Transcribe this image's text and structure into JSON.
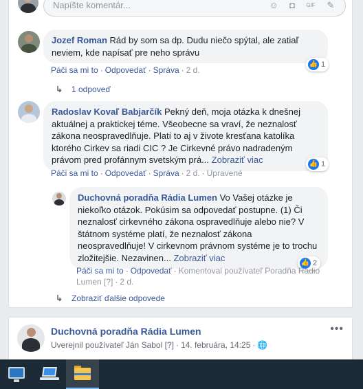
{
  "compose": {
    "placeholder": "Napíšte komentár...",
    "icons": [
      "emoji-icon",
      "camera-icon",
      "gif-icon",
      "sticker-icon"
    ]
  },
  "comments": [
    {
      "author": "Jozef Roman",
      "text": " Rád by som sa dp. Dudu niečo spýtal, ale zatiaľ neviem, kde napísať pre neho správu",
      "actions": {
        "like": "Páči sa mi to",
        "reply": "Odpovedať",
        "message": "Správa",
        "time": "2 d."
      },
      "reactions": "1",
      "replies_link": "1 odpoveď"
    },
    {
      "author": "Radoslav Kovaľ Babjarčík",
      "text": " Pekný deň, moja otázka k dnešnej aktuálnej a praktickej téme. Všeobecne sa vraví, že neznalosť zákona neospravedlňuje. Platí to aj v živote kresťana katolíka ktorého Cirkev sa riadi CIC ? Je Cirkevné právo nadradeným právom pred profánnym svetským prá...",
      "more": " Zobraziť viac",
      "actions": {
        "like": "Páči sa mi to",
        "reply": "Odpovedať",
        "message": "Správa",
        "time": "2 d.",
        "edited": "Upravené"
      },
      "reactions": "1"
    }
  ],
  "reply": {
    "author": "Duchovná poradňa Rádia Lumen",
    "text": " Vo Vašej otázke je niekoľko otázok. Pokúsim sa odpovedať postupne. (1) Či neznalosť cirkevného zákona ospravedlňuje alebo nie? V štátnom systéme platí, že neznalosť zákona neospravedlňuje! V cirkevnom právnom systéme je to trochu zložitejšie. Nezavinen...",
    "more": " Zobraziť viac",
    "actions": {
      "like": "Páči sa mi to",
      "reply": "Odpovedať",
      "commented_by": "Komentoval používateľ Poradňa Rádio",
      "commented_by_2": "Lumen",
      "q": "[?]",
      "time": "2 d."
    },
    "reactions": "2"
  },
  "more_replies": "Zobraziť ďalšie odpovede",
  "post": {
    "author": "Duchovná poradňa Rádia Lumen",
    "published_by": "Uverejnil používateľ Ján Sabol",
    "q": "[?]",
    "date": "14. februára, 14:25",
    "menu": "•••"
  },
  "taskbar": {
    "apps": [
      "monitor-app",
      "network-laptop-app",
      "file-explorer-app"
    ]
  },
  "colors": {
    "link": "#385898",
    "like": "#1877f2",
    "bubble": "#f2f3f5",
    "taskbar": "#1b2a35"
  }
}
